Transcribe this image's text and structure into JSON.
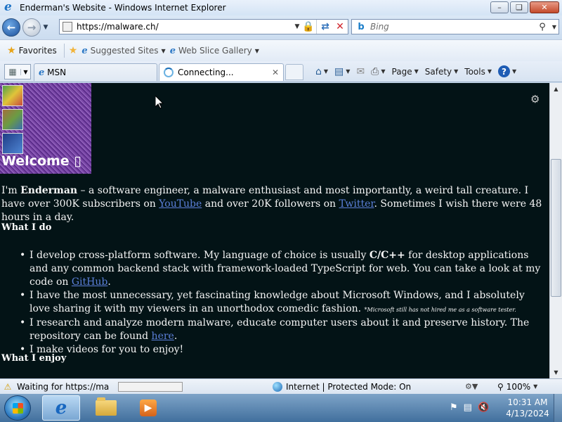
{
  "window": {
    "title": "Enderman's Website - Windows Internet Explorer",
    "minimize_label": "–",
    "maximize_label": "❏",
    "close_label": "✕"
  },
  "address": {
    "url": "https://malware.ch/",
    "search_placeholder": "Bing"
  },
  "favorites_bar": {
    "favorites_label": "Favorites",
    "items": [
      {
        "label": "Suggested Sites"
      },
      {
        "label": "Web Slice Gallery"
      }
    ]
  },
  "tabs": [
    {
      "label": "MSN",
      "active": false
    },
    {
      "label": "Connecting...",
      "active": true
    }
  ],
  "command_bar": {
    "page_label": "Page",
    "safety_label": "Safety",
    "tools_label": "Tools",
    "help_label": "?"
  },
  "page": {
    "banner_title": "Welcome ▯",
    "intro": {
      "im": "I'm ",
      "name": "Enderman",
      "part1": " – a software engineer, a malware enthusiast and most importantly, a weird tall creature. I have over 300K subscribers on ",
      "youtube": "YouTube",
      "part2": " and over 20K followers on ",
      "twitter": "Twitter",
      "part3": ". Sometimes I wish there were 48 hours in a day."
    },
    "what_i_do_heading": "What I do",
    "bullets": {
      "b1_a": "I develop cross-platform software. My language of choice is usually ",
      "b1_bold": "C/C++",
      "b1_b": " for desktop applications and any common backend stack with framework-loaded TypeScript for web. You can take a look at my code on ",
      "b1_link": "GitHub",
      "b1_c": ".",
      "b2_a": "I have the most unnecessary, yet fascinating knowledge about Microsoft Windows, and I absolutely love sharing it with my viewers in an unorthodox comedic fashion.",
      "b2_small": "*Microsoft still has not hired me as a software tester.",
      "b3_a": "I research and analyze modern malware, educate computer users about it and preserve history. The repository can be found ",
      "b3_link": "here",
      "b3_b": ".",
      "b4": "I make videos for you to enjoy!"
    },
    "what_i_enjoy_heading": "What I enjoy"
  },
  "status": {
    "text": "Waiting for https://ma",
    "progress_fraction": 0.0,
    "zone": "Internet | Protected Mode: On",
    "zoom": "100%"
  },
  "taskbar": {
    "time": "10:31 AM",
    "date": "4/13/2024"
  },
  "icons": [
    "ie-logo-icon",
    "back-icon",
    "forward-icon",
    "lock-icon",
    "refresh-icon",
    "stop-icon",
    "bing-icon",
    "search-icon",
    "star-icon",
    "home-icon",
    "feeds-icon",
    "mail-icon",
    "print-icon",
    "help-icon",
    "gear-icon",
    "warning-icon",
    "globe-icon",
    "start-orb-icon",
    "folder-icon",
    "media-player-icon",
    "flag-icon",
    "network-icon",
    "volume-muted-icon"
  ]
}
